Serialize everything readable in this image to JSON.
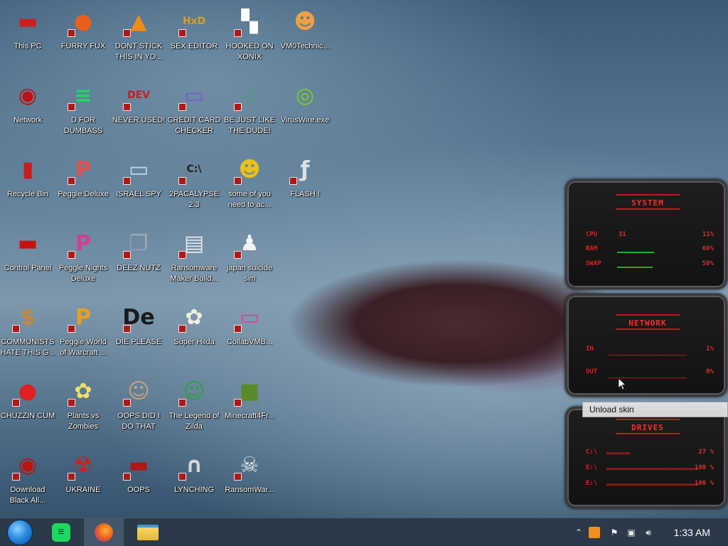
{
  "desktop": {
    "icons": [
      {
        "label": "This PC",
        "icon": "this-pc-icon",
        "color": "#cc2020",
        "glyph": "▬"
      },
      {
        "label": "FURRY FUX",
        "icon": "firefox-icon",
        "color": "#e8601c",
        "glyph": "●"
      },
      {
        "label": "DONT STICK THIS IN YO...",
        "icon": "vlc-cone-icon",
        "color": "#f28c12",
        "glyph": "▲"
      },
      {
        "label": "SEX EDITOR",
        "icon": "hex-editor-icon",
        "color": "#d8a020",
        "glyph": "HxD"
      },
      {
        "label": "HOOKED ON XONIX",
        "icon": "xonix-game-icon",
        "color": "#ffffff",
        "glyph": "▚"
      },
      {
        "label": "VM0Technic...",
        "icon": "doctor-avatar-icon",
        "color": "#f0a040",
        "glyph": "☻"
      },
      {
        "label": "Network",
        "icon": "network-globe-icon",
        "color": "#c01010",
        "glyph": "◉"
      },
      {
        "label": "D FOR DUMBASS",
        "icon": "green-app-icon",
        "color": "#1ed760",
        "glyph": "≡"
      },
      {
        "label": "NEVER USED!",
        "icon": "dev-cpp-icon",
        "color": "#c81e1e",
        "glyph": "DEV"
      },
      {
        "label": "CREDIT CARD CHECKER",
        "icon": "credit-card-icon",
        "color": "#7a5ad0",
        "glyph": "▭"
      },
      {
        "label": "BE JUST LIKE THE DUDE!",
        "icon": "gnome-santa-icon",
        "color": "#4c9a70",
        "glyph": "☃"
      },
      {
        "label": "VirusWire.exe",
        "icon": "lime-disc-icon",
        "color": "#7cd01c",
        "glyph": "◎"
      },
      {
        "label": "Recycle Bin",
        "icon": "recycle-bin-icon",
        "color": "#c81e1e",
        "glyph": "▮"
      },
      {
        "label": "Peggle Deluxe",
        "icon": "peggle-icon",
        "color": "#e05050",
        "glyph": "P"
      },
      {
        "label": "ISRAEL SPY",
        "icon": "network-computer-icon",
        "color": "#c0d8f0",
        "glyph": "▭"
      },
      {
        "label": "2PACALYPSE 2.3",
        "icon": "terminal-icon",
        "color": "#202020",
        "glyph": "C:\\"
      },
      {
        "label": "some of you need to ac...",
        "icon": "dog-cartoon-icon",
        "color": "#e8c018",
        "glyph": "☻"
      },
      {
        "label": "FLASH !",
        "icon": "flash-document-icon",
        "color": "#e0e0e0",
        "glyph": "ƒ"
      },
      {
        "label": "Control Panel",
        "icon": "control-panel-icon",
        "color": "#c81010",
        "glyph": "▬"
      },
      {
        "label": "Peggle Nights Deluxe",
        "icon": "peggle-nights-icon",
        "color": "#d04090",
        "glyph": "P"
      },
      {
        "label": "DEEZ NUTZ",
        "icon": "window-stack-icon",
        "color": "#9aa8b8",
        "glyph": "❐"
      },
      {
        "label": "Ransomware Maker Build...",
        "icon": "app-window-icon",
        "color": "#e8e8e8",
        "glyph": "▤"
      },
      {
        "label": "japan suicide sim",
        "icon": "white-document-icon",
        "color": "#f4f4f4",
        "glyph": "♟"
      },
      {
        "label": "COMMUNISTS HATE THIS G...",
        "icon": "money-bag-icon",
        "color": "#c08a3a",
        "glyph": "$"
      },
      {
        "label": "Peggle World of Warcraft ...",
        "icon": "peggle-wow-icon",
        "color": "#e8a020",
        "glyph": "P"
      },
      {
        "label": "DIE PLEASE",
        "icon": "de-badge-icon",
        "color": "#1a1a1a",
        "glyph": "De"
      },
      {
        "label": "Super Hilda",
        "icon": "pixel-character-icon",
        "color": "#f0f0e0",
        "glyph": "✿"
      },
      {
        "label": "CollabVMB...",
        "icon": "pink-monitor-icon",
        "color": "#e040a0",
        "glyph": "▭"
      },
      {
        "label": "CHUZZIN CUM",
        "icon": "chuzzle-icon",
        "color": "#e02020",
        "glyph": "●"
      },
      {
        "label": "Plants vs Zombies",
        "icon": "flower-icon",
        "color": "#f0e060",
        "glyph": "✿"
      },
      {
        "label": "OOPS DID I DO THAT",
        "icon": "portrait-painting-icon",
        "color": "#c8a080",
        "glyph": "☺"
      },
      {
        "label": "The Legend of Zilda",
        "icon": "pixel-hero-icon",
        "color": "#30a040",
        "glyph": "☺"
      },
      {
        "label": "Minecraft4Fr...",
        "icon": "grass-block-icon",
        "color": "#5a8a2a",
        "glyph": "■"
      },
      {
        "label": "Download Black All...",
        "icon": "red-globe-icon",
        "color": "#c01010",
        "glyph": "◉"
      },
      {
        "label": "UKRAINE",
        "icon": "radiation-icon",
        "color": "#e01818",
        "glyph": "☢"
      },
      {
        "label": "OOPS",
        "icon": "red-panel-icon",
        "color": "#b01818",
        "glyph": "▬"
      },
      {
        "label": "LYNCHING",
        "icon": "noose-icon",
        "color": "#d8d8d8",
        "glyph": "∩"
      },
      {
        "label": "RansomWar...",
        "icon": "skull-crossbones-icon",
        "color": "#e8e8e8",
        "glyph": "☠"
      }
    ]
  },
  "widgets": {
    "system": {
      "title": "SYSTEM",
      "rows": [
        {
          "label": "CPU",
          "extra": "31",
          "value": "11%",
          "fill": 0.0
        },
        {
          "label": "RAM",
          "value": "66%",
          "fill": 0.26
        },
        {
          "label": "SWAP",
          "value": "58%",
          "fill": 0.5
        }
      ]
    },
    "network": {
      "title": "NETWORK",
      "rows": [
        {
          "label": "IN",
          "value": "1%"
        },
        {
          "label": "OUT",
          "value": "0%"
        }
      ]
    },
    "drives": {
      "title": "DRIVES",
      "rows": [
        {
          "label": "C:\\",
          "value": "27 %",
          "fill": 0.27
        },
        {
          "label": "E:\\",
          "value": "100 %",
          "fill": 1.0
        },
        {
          "label": "E:\\",
          "value": "100 %",
          "fill": 1.0
        }
      ]
    }
  },
  "context_menu": {
    "item": "Unload skin"
  },
  "taskbar": {
    "start_icon": "start-orb-icon",
    "pinned": [
      {
        "name": "green-app-icon",
        "color": "#1ed760"
      },
      {
        "name": "firefox-icon",
        "color": "#e8601c",
        "active": true
      },
      {
        "name": "file-explorer-icon",
        "color": "#f0c040"
      }
    ],
    "tray": [
      "tray-app-icon",
      "security-flag-icon",
      "network-tray-icon",
      "volume-icon"
    ],
    "clock": "1:33 AM"
  }
}
